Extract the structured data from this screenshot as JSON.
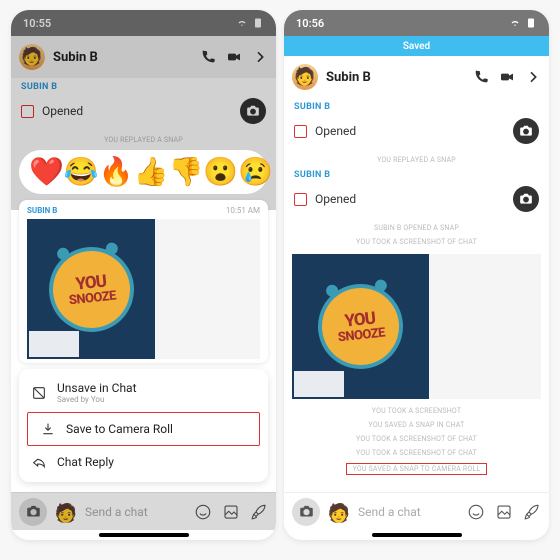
{
  "left": {
    "status": {
      "time": "10:55"
    },
    "header": {
      "name": "Subin B"
    },
    "sender": "SUBIN B",
    "opened": "Opened",
    "sys1": "YOU REPLAYED A SNAP",
    "snap": {
      "sender": "SUBIN B",
      "time": "10:51 AM",
      "line1": "YOU",
      "line2": "SNOOZE"
    },
    "emojis": [
      "❤️",
      "😂",
      "🔥",
      "👍",
      "👎",
      "😮",
      "😢"
    ],
    "menu": {
      "unsave": "Unsave in Chat",
      "sub": "Saved by You",
      "save": "Save to Camera Roll",
      "reply": "Chat Reply"
    },
    "chat_placeholder": "Send a chat"
  },
  "right": {
    "status": {
      "time": "10:56"
    },
    "banner": "Saved",
    "header": {
      "name": "Subin B"
    },
    "sender": "SUBIN B",
    "opened": "Opened",
    "sys1": "YOU REPLAYED A SNAP",
    "sys2": "SUBIN B OPENED A SNAP",
    "sys3": "YOU TOOK A SCREENSHOT OF CHAT",
    "snap": {
      "line1": "YOU",
      "line2": "SNOOZE"
    },
    "tail": [
      "YOU TOOK A SCREENSHOT",
      "YOU SAVED A SNAP IN CHAT",
      "YOU TOOK A SCREENSHOT OF CHAT",
      "YOU TOOK A SCREENSHOT OF CHAT",
      "YOU SAVED A SNAP TO CAMERA ROLL"
    ],
    "chat_placeholder": "Send a chat"
  }
}
